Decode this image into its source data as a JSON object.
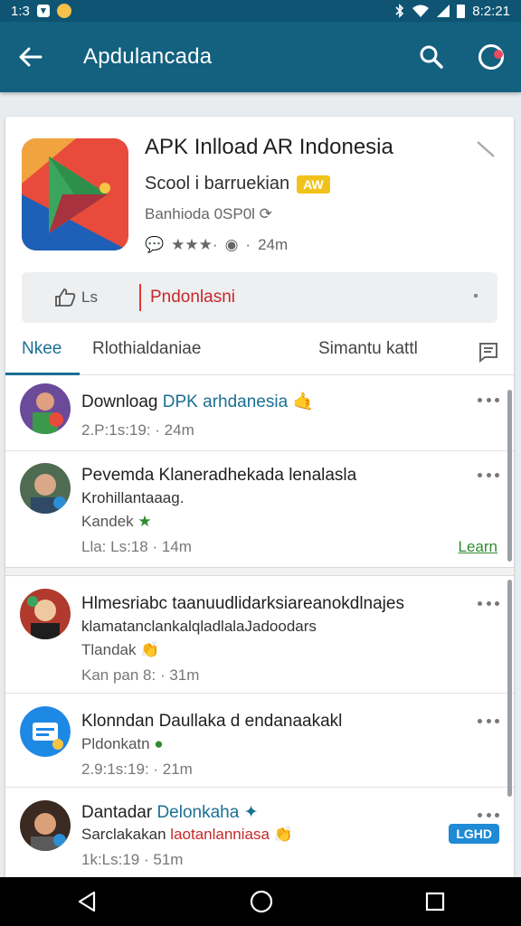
{
  "status_bar": {
    "time": "1:3",
    "right_time": "8:2:21"
  },
  "app_bar": {
    "title": "Apdulancada"
  },
  "app": {
    "title": "APK Inlload AR Indonesia",
    "subtitle": "Scool i barruekian",
    "badge": "AW",
    "meta_line1": "Banhioda 0SP0l",
    "meta_rating": "★★★·",
    "meta_size": "24m"
  },
  "actions": {
    "like_label": "Ls",
    "download_label": "Pndonlasni"
  },
  "tabs": [
    {
      "label": "Nkee"
    },
    {
      "label": "Rlothialdaniae"
    },
    {
      "label": "Simantu kattl"
    }
  ],
  "feed": [
    {
      "title_prefix": "Downloag",
      "title_highlight": "DPK arhdanesia",
      "meta": "2.P:1s:19: · 24m"
    },
    {
      "title": "Pevemda Klaneradhekada lenalasla",
      "subtitle": "Krohillantaaag.",
      "tag": "Kandek",
      "meta": "Lla: Ls:18 · 14m",
      "link": "Learn"
    },
    {
      "title": "Hlmesriabc taanuudlidarksiareanokdlnajes",
      "subtitle": "klamatanclankalqladlalaJadoodars",
      "tag": "Tlandak",
      "meta": "Kan pan 8: · 31m"
    },
    {
      "title": "Klonndan Daullaka d endanaakakl",
      "subtitle": "Pldonkatn",
      "meta": "2.9:1s:19: · 21m"
    },
    {
      "title_prefix": "Dantadar",
      "title_highlight": "Delonkaha",
      "subtitle_prefix": "Sarclakakan",
      "subtitle_highlight": "laotanlanniasa",
      "meta": "1k:Ls:19 · 51m",
      "button": "LGHD"
    }
  ],
  "colors": {
    "appbar": "#13607f",
    "accent": "#1b6f93",
    "download_red": "#c62828"
  }
}
